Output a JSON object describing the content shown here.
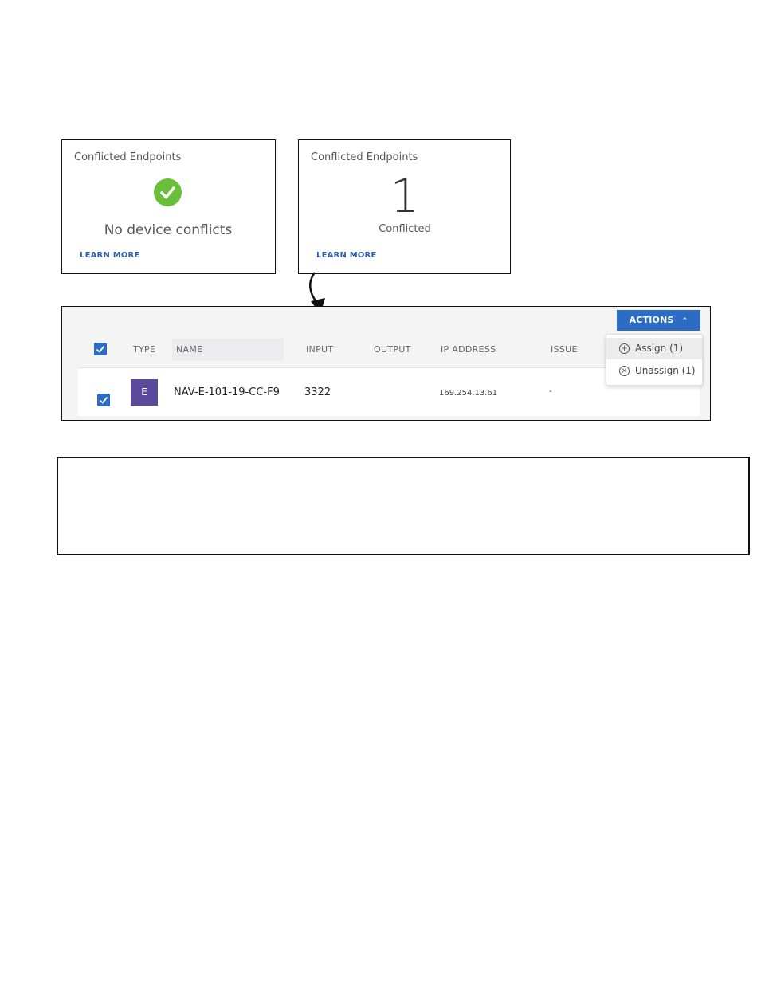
{
  "card_ok": {
    "title": "Conflicted Endpoints",
    "status_text": "No device conflicts",
    "link": "LEARN MORE",
    "icon": "check-circle-icon",
    "icon_color": "#6abf3a"
  },
  "card_conflict": {
    "title": "Conflicted Endpoints",
    "count": "1",
    "count_label": "Conflicted",
    "link": "LEARN MORE"
  },
  "table": {
    "columns": {
      "type": "TYPE",
      "name": "NAME",
      "input": "INPUT",
      "output": "OUTPUT",
      "ip": "IP ADDRESS",
      "issue": "ISSUE"
    },
    "rows": [
      {
        "type": "E",
        "name": "NAV-E-101-19-CC-F9",
        "input": "3322",
        "output": "",
        "ip": "169.254.13.61",
        "issue": "-"
      }
    ],
    "actions_label": "ACTIONS",
    "actions_menu": [
      {
        "label": "Assign (1)",
        "icon": "plus-circle-icon"
      },
      {
        "label": "Unassign (1)",
        "icon": "x-circle-icon"
      }
    ]
  },
  "colors": {
    "accent": "#2d6cc4",
    "type_badge": "#5b4a9c",
    "link": "#2d5fa8"
  }
}
